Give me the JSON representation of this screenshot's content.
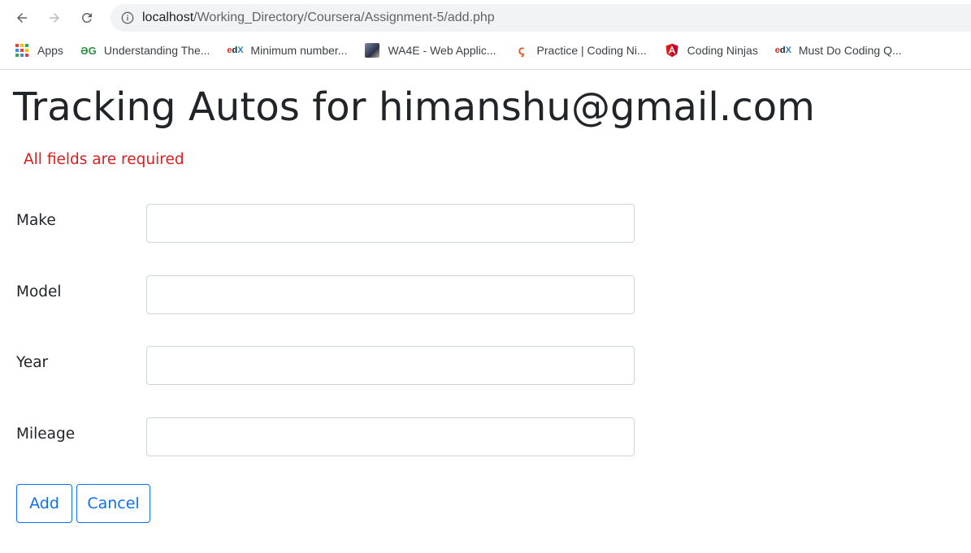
{
  "browser": {
    "url_host": "localhost",
    "url_path": "/Working_Directory/Coursera/Assignment-5/add.php",
    "bookmarks": [
      {
        "label": "Apps",
        "icon": "apps-grid-icon"
      },
      {
        "label": "Understanding The...",
        "icon": "gfg-icon"
      },
      {
        "label": "Minimum number...",
        "icon": "edx-icon"
      },
      {
        "label": "WA4E - Web Applic...",
        "icon": "avatar-icon"
      },
      {
        "label": "Practice | Coding Ni...",
        "icon": "coding-ninjas-icon"
      },
      {
        "label": "Coding Ninjas",
        "icon": "angular-icon"
      },
      {
        "label": "Must Do Coding Q...",
        "icon": "edx-icon"
      }
    ]
  },
  "page": {
    "title": "Tracking Autos for himanshu@gmail.com",
    "error": "All fields are required",
    "fields": [
      {
        "label": "Make",
        "value": ""
      },
      {
        "label": "Model",
        "value": ""
      },
      {
        "label": "Year",
        "value": ""
      },
      {
        "label": "Mileage",
        "value": ""
      }
    ],
    "add_label": "Add",
    "cancel_label": "Cancel"
  },
  "colors": {
    "error": "#e11b1b",
    "button": "#0d6efd",
    "text": "#212529"
  }
}
